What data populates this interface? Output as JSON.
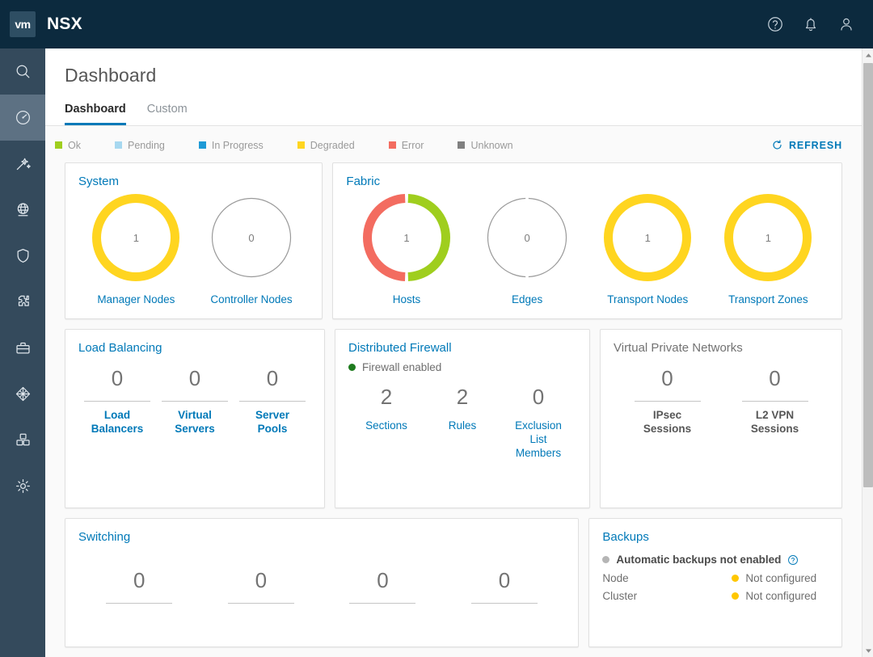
{
  "header": {
    "logo_text": "vm",
    "app_title": "NSX",
    "icons": [
      {
        "name": "help-icon",
        "glyph": "help"
      },
      {
        "name": "notifications-bell-icon",
        "glyph": "bell"
      },
      {
        "name": "user-account-icon",
        "glyph": "user"
      }
    ]
  },
  "sidebar": {
    "items": [
      {
        "name": "search",
        "icon": "search-icon",
        "active": false
      },
      {
        "name": "dashboard",
        "icon": "dashboard-gauge-icon",
        "active": true
      },
      {
        "name": "policy",
        "icon": "magic-wand-icon",
        "active": false
      },
      {
        "name": "networking",
        "icon": "globe-network-icon",
        "active": false
      },
      {
        "name": "security",
        "icon": "shield-icon",
        "active": false
      },
      {
        "name": "inventory",
        "icon": "puzzle-piece-icon",
        "active": false
      },
      {
        "name": "tools",
        "icon": "toolbox-icon",
        "active": false
      },
      {
        "name": "fabric",
        "icon": "network-grid-icon",
        "active": false
      },
      {
        "name": "groups",
        "icon": "boxes-stack-icon",
        "active": false
      },
      {
        "name": "system-settings",
        "icon": "gear-icon",
        "active": false
      }
    ]
  },
  "page": {
    "title": "Dashboard",
    "tabs": [
      {
        "label": "Dashboard",
        "active": true
      },
      {
        "label": "Custom",
        "active": false
      }
    ]
  },
  "legend": {
    "items": [
      {
        "label": "Ok",
        "color": "#9fce1e"
      },
      {
        "label": "Pending",
        "color": "#a7d8f0"
      },
      {
        "label": "In Progress",
        "color": "#1e9ad6"
      },
      {
        "label": "Degraded",
        "color": "#ffd520"
      },
      {
        "label": "Error",
        "color": "#f36c60"
      },
      {
        "label": "Unknown",
        "color": "#808080"
      }
    ],
    "refresh_label": "REFRESH"
  },
  "cards": {
    "system": {
      "title": "System",
      "donuts": [
        {
          "label": "Manager Nodes",
          "value": "1",
          "segments": [
            {
              "color": "#ffd520",
              "fraction": 1.0
            }
          ]
        },
        {
          "label": "Controller Nodes",
          "value": "0",
          "segments": [
            {
              "color": "#9a9a9a",
              "fraction": 1.0
            }
          ],
          "empty": true
        }
      ]
    },
    "fabric": {
      "title": "Fabric",
      "donuts": [
        {
          "label": "Hosts",
          "value": "1",
          "segments": [
            {
              "color": "#9fce1e",
              "fraction": 0.5
            },
            {
              "color": "#f36c60",
              "fraction": 0.5
            }
          ]
        },
        {
          "label": "Edges",
          "value": "0",
          "segments": [
            {
              "color": "#9a9a9a",
              "fraction": 0.5
            },
            {
              "color": "#9a9a9a",
              "fraction": 0.5
            }
          ],
          "empty": true
        },
        {
          "label": "Transport Nodes",
          "value": "1",
          "segments": [
            {
              "color": "#ffd520",
              "fraction": 1.0
            }
          ]
        },
        {
          "label": "Transport Zones",
          "value": "1",
          "segments": [
            {
              "color": "#ffd520",
              "fraction": 1.0
            }
          ]
        }
      ]
    },
    "load_balancing": {
      "title": "Load Balancing",
      "metrics": [
        {
          "value": "0",
          "label": "Load\nBalancers"
        },
        {
          "value": "0",
          "label": "Virtual\nServers"
        },
        {
          "value": "0",
          "label": "Server\nPools"
        }
      ]
    },
    "distributed_firewall": {
      "title": "Distributed Firewall",
      "status": {
        "text": "Firewall enabled",
        "color": "#1e7b1e"
      },
      "metrics": [
        {
          "value": "2",
          "label": "Sections"
        },
        {
          "value": "2",
          "label": "Rules"
        },
        {
          "value": "0",
          "label": "Exclusion\nList\nMembers"
        }
      ]
    },
    "vpn": {
      "title": "Virtual Private Networks",
      "metrics": [
        {
          "value": "0",
          "label": "IPsec\nSessions"
        },
        {
          "value": "0",
          "label": "L2 VPN\nSessions"
        }
      ]
    },
    "switching": {
      "title": "Switching",
      "metrics": [
        {
          "value": "0",
          "label": ""
        },
        {
          "value": "0",
          "label": ""
        },
        {
          "value": "0",
          "label": ""
        },
        {
          "value": "0",
          "label": ""
        }
      ]
    },
    "backups": {
      "title": "Backups",
      "status": {
        "text": "Automatic backups not enabled",
        "color": "#b5b5b5"
      },
      "rows": [
        {
          "key": "Node",
          "value": "Not configured",
          "color": "#ffc700"
        },
        {
          "key": "Cluster",
          "value": "Not configured",
          "color": "#ffc700"
        }
      ]
    }
  }
}
